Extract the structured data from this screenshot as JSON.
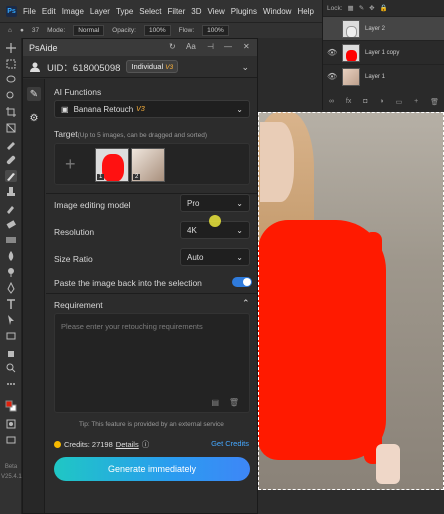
{
  "menubar": {
    "app_logo": "Ps",
    "items": [
      "File",
      "Edit",
      "Image",
      "Layer",
      "Type",
      "Select",
      "Filter",
      "3D",
      "View",
      "Plugins",
      "Window",
      "Help"
    ]
  },
  "options": {
    "brush_size": "37",
    "mode_label": "Mode:",
    "mode_value": "Normal",
    "opacity_label": "Opacity:",
    "opacity_value": "100%",
    "flow_label": "Flow:",
    "flow_value": "100%"
  },
  "toolbar": {
    "beta_label": "Beta",
    "version": "V25.4.1"
  },
  "layers": {
    "lock_label": "Lock:",
    "items": [
      {
        "name": "Layer 2",
        "selected": true
      },
      {
        "name": "Layer 1 copy",
        "selected": false
      },
      {
        "name": "Layer 1",
        "selected": false
      }
    ]
  },
  "panel": {
    "title": "PsAide",
    "uid": "UID：618005098",
    "tier": "Individual",
    "tier_version": "V3",
    "ai_functions_label": "AI Functions",
    "ai_function_value": "Banana Retouch",
    "ai_function_version": "V3",
    "target_label": "Target",
    "target_hint": "(Up to 5 images, can be dragged and sorted)",
    "target_images": [
      "1",
      "2"
    ],
    "model_label": "Image editing model",
    "model_value": "Pro",
    "resolution_label": "Resolution",
    "resolution_value": "4K",
    "size_ratio_label": "Size Ratio",
    "size_ratio_value": "Auto",
    "paste_label": "Paste the image back into the selection",
    "paste_enabled": true,
    "requirement_label": "Requirement",
    "requirement_placeholder": "Please enter your retouching requirements",
    "tip": "Tip: This feature is provided by an external service",
    "credits": "Credits: 27198",
    "details": "Details",
    "get_credits": "Get Credits",
    "generate": "Generate immediately"
  },
  "colors": {
    "accent": "#2a9cf0",
    "selection_red": "#ff1a00",
    "credit_coin": "#f6b900",
    "version_orange": "#ffb43c"
  }
}
